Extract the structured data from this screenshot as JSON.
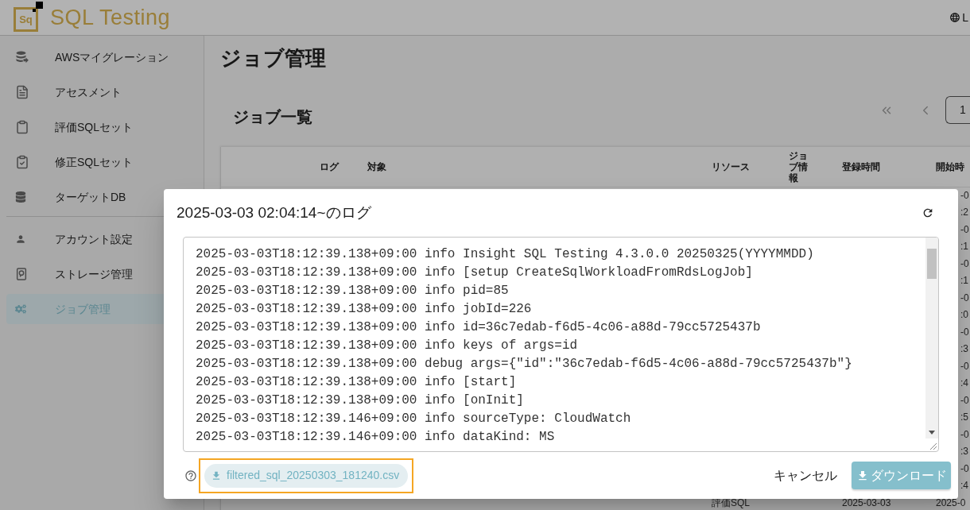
{
  "header": {
    "logo_mark": "Sq",
    "logo_text": "SQL Testing",
    "language_button": "L"
  },
  "sidebar": {
    "groups": [
      {
        "items": [
          {
            "label": "AWSマイグレーション",
            "selected": false
          },
          {
            "label": "アセスメント",
            "selected": false
          },
          {
            "label": "評価SQLセット",
            "selected": false
          },
          {
            "label": "修正SQLセット",
            "selected": false
          },
          {
            "label": "ターゲットDB",
            "selected": false
          }
        ]
      },
      {
        "items": [
          {
            "label": "アカウント設定",
            "selected": false
          },
          {
            "label": "ストレージ管理",
            "selected": false
          },
          {
            "label": "ジョブ管理",
            "selected": true
          }
        ]
      }
    ]
  },
  "page": {
    "title": "ジョブ管理"
  },
  "job_list": {
    "title": "ジョブ一覧",
    "pagination": {
      "current_page": "1"
    },
    "table": {
      "columns": [
        "ログ",
        "対象",
        "リソース",
        "ジョブ情報",
        "登録時間",
        "開始時"
      ],
      "rows": [
        {
          "start_date": "-0",
          "start_time": ":2"
        },
        {
          "start_date": "-0",
          "start_time": ":1"
        },
        {
          "start_date": "-0",
          "start_time": ":1"
        },
        {
          "start_date": "-0",
          "start_time": ":0"
        },
        {
          "start_date": "-0",
          "start_time": ":3"
        },
        {
          "start_date": "-0",
          "start_time": ":4"
        },
        {
          "start_date": "-0",
          "start_time": ":5"
        },
        {
          "start_date": "-0",
          "start_time": ":3"
        },
        {
          "start_date": "-0",
          "start_time": ":4"
        },
        {
          "resource": "評価SQL",
          "registered": "2025-03-03",
          "start_date": "2025-0"
        }
      ]
    }
  },
  "dialog": {
    "title": "2025-03-03 02:04:14~のログ",
    "log_lines": [
      "2025-03-03T18:12:39.138+09:00 info Insight SQL Testing 4.3.0.0 20250325(YYYYMMDD)",
      "2025-03-03T18:12:39.138+09:00 info [setup CreateSqlWorkloadFromRdsLogJob]",
      "2025-03-03T18:12:39.138+09:00 info pid=85",
      "2025-03-03T18:12:39.138+09:00 info jobId=226",
      "2025-03-03T18:12:39.138+09:00 info id=36c7edab-f6d5-4c06-a88d-79cc5725437b",
      "2025-03-03T18:12:39.138+09:00 info keys of args=id",
      "2025-03-03T18:12:39.138+09:00 debug args={\"id\":\"36c7edab-f6d5-4c06-a88d-79cc5725437b\"}",
      "2025-03-03T18:12:39.138+09:00 info [start]",
      "2025-03-03T18:12:39.138+09:00 info [onInit]",
      "2025-03-03T18:12:39.146+09:00 info sourceType: CloudWatch",
      "2025-03-03T18:12:39.146+09:00 info dataKind: MS"
    ],
    "file_link": {
      "label": "filtered_sql_20250303_181240.csv",
      "highlighted": true
    },
    "cancel_button": "キャンセル",
    "download_button": "ダウンロード"
  }
}
